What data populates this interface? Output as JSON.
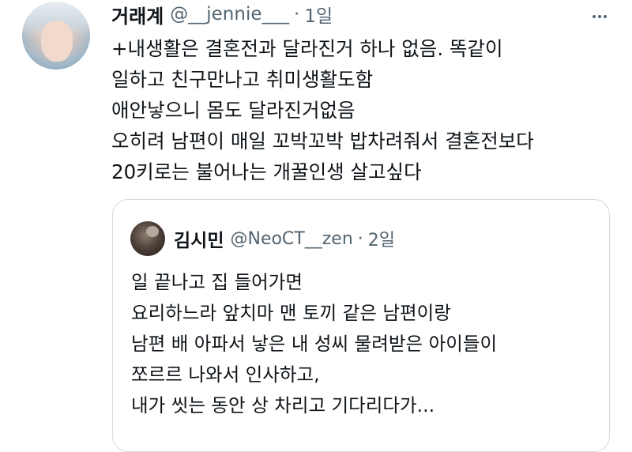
{
  "tweet": {
    "author_name": "거래계",
    "handle": "@__jennie___",
    "separator": "·",
    "time": "1일",
    "lines": [
      "+내생활은 결혼전과 달라진거 하나 없음. 똑같이",
      "일하고 친구만나고 취미생활도함",
      "애안낳으니 몸도 달라진거없음",
      "오히려 남편이 매일 꼬박꼬박 밥차려줘서 결혼전보다",
      "20키로는 불어나는 개꿀인생 살고싶다"
    ]
  },
  "quote": {
    "author_name": "김시민",
    "handle": "@NeoCT__zen",
    "separator": "·",
    "time": "2일",
    "lines": [
      "일 끝나고 집 들어가면",
      "요리하느라 앞치마 맨 토끼 같은 남편이랑",
      "남편 배 아파서 낳은 내 성씨 물려받은 아이들이",
      "쪼르르 나와서 인사하고,",
      "내가 씻는 동안 상 차리고 기다리다가..."
    ]
  },
  "icons": {
    "more": "more-horizontal-icon"
  }
}
